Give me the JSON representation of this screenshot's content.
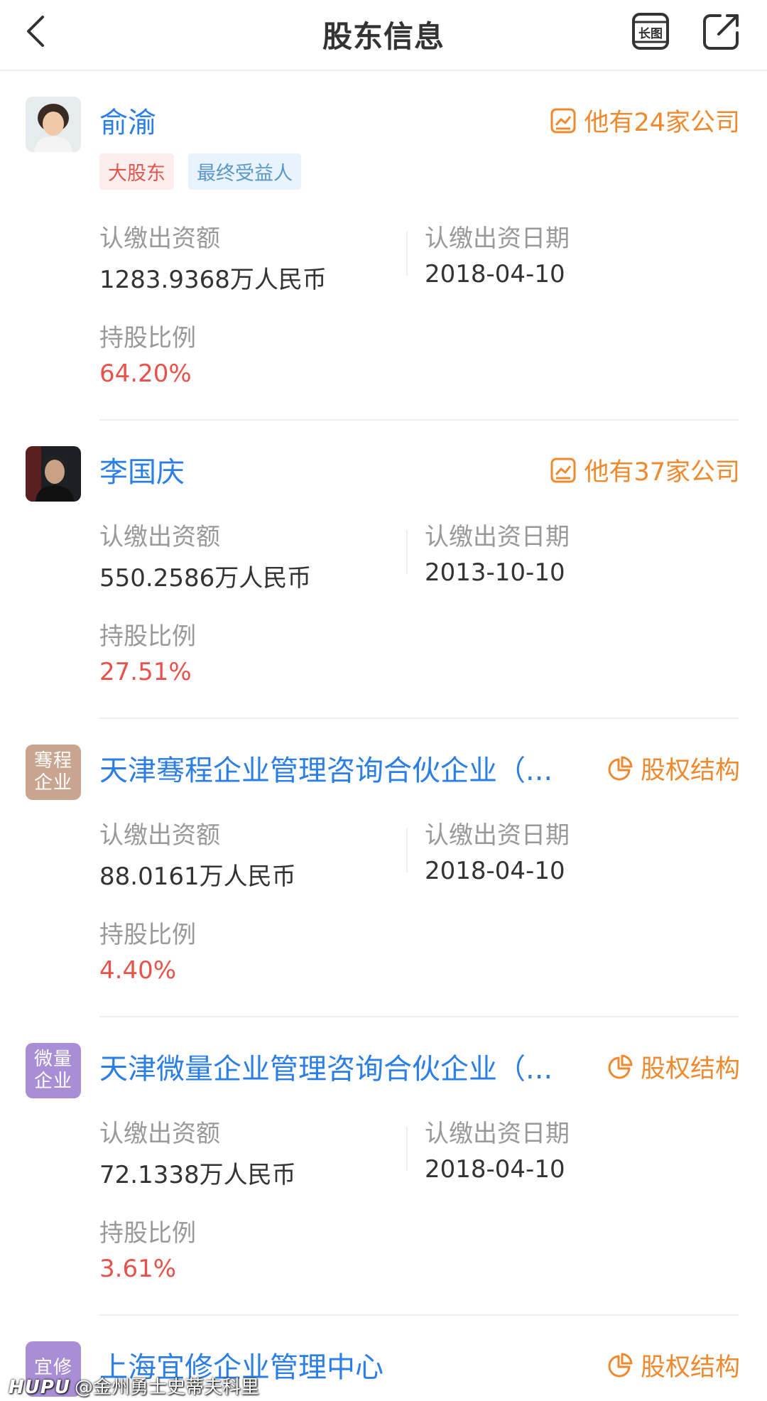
{
  "header": {
    "title": "股东信息",
    "long_image_label": "长图"
  },
  "labels": {
    "amount": "认缴出资额",
    "date": "认缴出资日期",
    "ratio": "持股比例"
  },
  "shareholders": [
    {
      "name": "俞渝",
      "action": "他有24家公司",
      "tags": [
        "大股东",
        "最终受益人"
      ],
      "amount": "1283.9368万人民币",
      "date": "2018-04-10",
      "ratio": "64.20%"
    },
    {
      "name": "李国庆",
      "action": "他有37家公司",
      "amount": "550.2586万人民币",
      "date": "2013-10-10",
      "ratio": "27.51%"
    },
    {
      "name": "天津骞程企业管理咨询合伙企业（...",
      "logo_text": "骞程企业",
      "logo_color": "#c9a58f",
      "action": "股权结构",
      "amount": "88.0161万人民币",
      "date": "2018-04-10",
      "ratio": "4.40%"
    },
    {
      "name": "天津微量企业管理咨询合伙企业（...",
      "logo_text": "微量企业",
      "logo_color": "#a98ed6",
      "action": "股权结构",
      "amount": "72.1338万人民币",
      "date": "2018-04-10",
      "ratio": "3.61%"
    },
    {
      "name": "上海宜修企业管理中心",
      "logo_text": "宜修",
      "logo_color": "#a98ed6",
      "action": "股权结构"
    }
  ],
  "watermark": {
    "brand": "HUPU",
    "text": "@金州勇士史蒂夫科里"
  },
  "colors": {
    "link_blue": "#2a7ee6",
    "orange": "#f0892d",
    "red": "#e8524a",
    "label_gray": "#999999"
  }
}
